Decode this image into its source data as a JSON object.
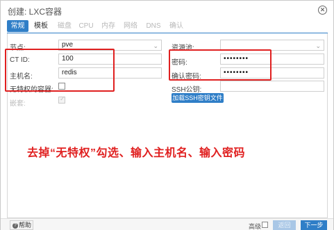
{
  "dialog": {
    "title": "创建: LXC容器",
    "close_icon": "circle-x"
  },
  "tabs": [
    {
      "label": "常规",
      "state": "active"
    },
    {
      "label": "模板",
      "state": "enabled"
    },
    {
      "label": "磁盘",
      "state": "disabled"
    },
    {
      "label": "CPU",
      "state": "disabled"
    },
    {
      "label": "内存",
      "state": "disabled"
    },
    {
      "label": "网络",
      "state": "disabled"
    },
    {
      "label": "DNS",
      "state": "disabled"
    },
    {
      "label": "确认",
      "state": "disabled"
    }
  ],
  "form_left": {
    "node_label": "节点:",
    "node_value": "pve",
    "ctid_label": "CT ID:",
    "ctid_value": "100",
    "hostname_label": "主机名:",
    "hostname_value": "redis",
    "unprivileged_label": "无特权的容器:",
    "unprivileged_checked": false,
    "nesting_label": "嵌套:",
    "nesting_checked": true
  },
  "form_right": {
    "pool_label": "资源池:",
    "pool_value": "",
    "password_label": "密码:",
    "password_value": "••••••••",
    "confirm_label": "确认密码:",
    "confirm_value": "••••••••",
    "ssh_label": "SSH公钥:",
    "ssh_value": "",
    "load_ssh_button": "加载SSH密钥文件"
  },
  "annotation": {
    "text": "去掉“无特权”勾选、输入主机名、输入密码",
    "color": "#e02020"
  },
  "footer": {
    "help_label": "帮助",
    "advanced_label": "高级",
    "advanced_checked": false,
    "back_label": "返回",
    "next_label": "下一步"
  },
  "colors": {
    "accent": "#2f7ec7",
    "annotation_red": "#e02020"
  }
}
